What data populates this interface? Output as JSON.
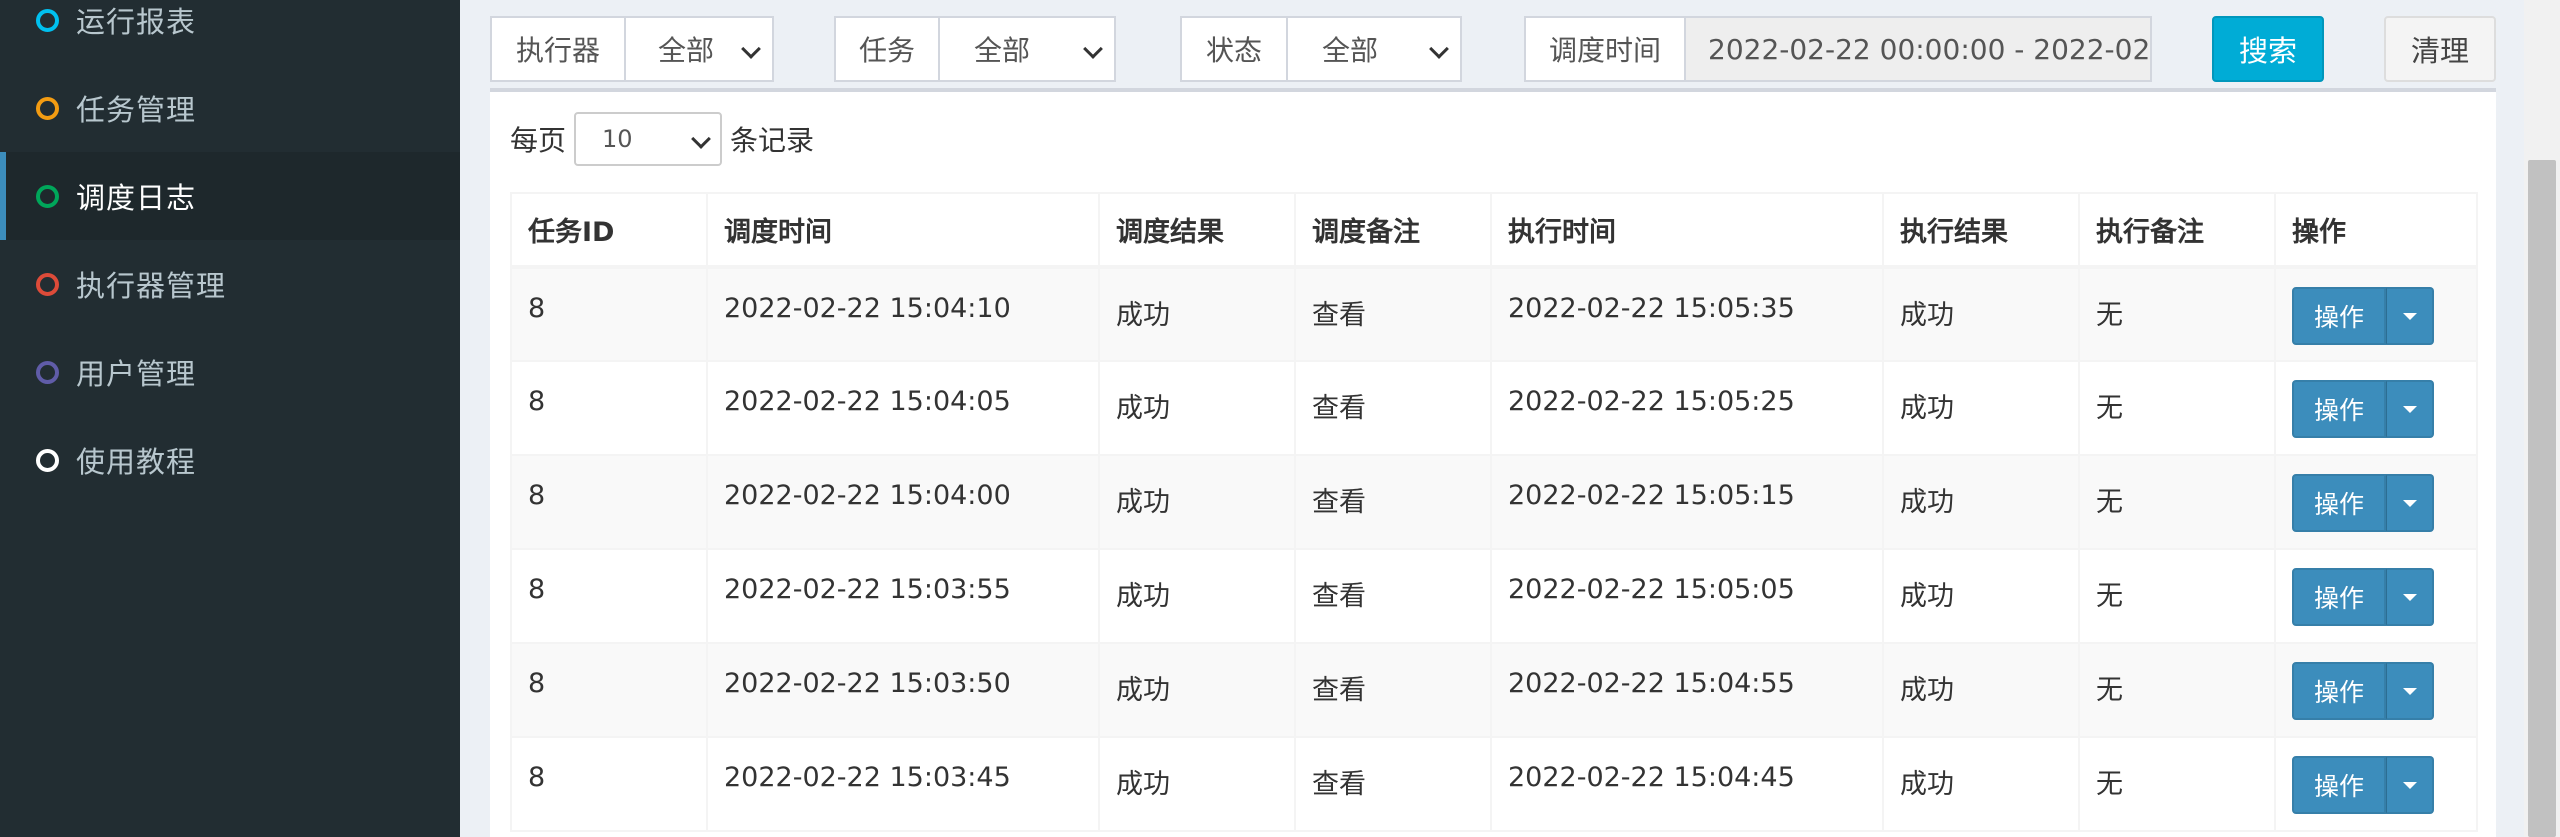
{
  "sidebar": {
    "items": [
      {
        "label": "运行报表",
        "color": "#00c0ef",
        "active": false
      },
      {
        "label": "任务管理",
        "color": "#f39c12",
        "active": false
      },
      {
        "label": "调度日志",
        "color": "#00a65a",
        "active": true
      },
      {
        "label": "执行器管理",
        "color": "#dd4b39",
        "active": false
      },
      {
        "label": "用户管理",
        "color": "#605ca8",
        "active": false
      },
      {
        "label": "使用教程",
        "color": "#ffffff",
        "active": false
      }
    ]
  },
  "filters": {
    "executor": {
      "label": "执行器",
      "value": "全部"
    },
    "task": {
      "label": "任务",
      "value": "全部"
    },
    "status": {
      "label": "状态",
      "value": "全部"
    },
    "time": {
      "label": "调度时间",
      "value": "2022-02-22 00:00:00 - 2022-02-2"
    },
    "search_label": "搜索",
    "clear_label": "清理"
  },
  "page_size": {
    "prefix": "每页",
    "value": "10",
    "suffix": "条记录"
  },
  "table": {
    "headers": [
      "任务ID",
      "调度时间",
      "调度结果",
      "调度备注",
      "执行时间",
      "执行结果",
      "执行备注",
      "操作"
    ],
    "rows": [
      {
        "id": "8",
        "trigger_time": "2022-02-22 15:04:10",
        "trigger_result": "成功",
        "trigger_note": "查看",
        "exec_time": "2022-02-22 15:05:35",
        "exec_result": "成功",
        "exec_note": "无",
        "op": "操作"
      },
      {
        "id": "8",
        "trigger_time": "2022-02-22 15:04:05",
        "trigger_result": "成功",
        "trigger_note": "查看",
        "exec_time": "2022-02-22 15:05:25",
        "exec_result": "成功",
        "exec_note": "无",
        "op": "操作"
      },
      {
        "id": "8",
        "trigger_time": "2022-02-22 15:04:00",
        "trigger_result": "成功",
        "trigger_note": "查看",
        "exec_time": "2022-02-22 15:05:15",
        "exec_result": "成功",
        "exec_note": "无",
        "op": "操作"
      },
      {
        "id": "8",
        "trigger_time": "2022-02-22 15:03:55",
        "trigger_result": "成功",
        "trigger_note": "查看",
        "exec_time": "2022-02-22 15:05:05",
        "exec_result": "成功",
        "exec_note": "无",
        "op": "操作"
      },
      {
        "id": "8",
        "trigger_time": "2022-02-22 15:03:50",
        "trigger_result": "成功",
        "trigger_note": "查看",
        "exec_time": "2022-02-22 15:04:55",
        "exec_result": "成功",
        "exec_note": "无",
        "op": "操作"
      },
      {
        "id": "8",
        "trigger_time": "2022-02-22 15:03:45",
        "trigger_result": "成功",
        "trigger_note": "查看",
        "exec_time": "2022-02-22 15:04:45",
        "exec_result": "成功",
        "exec_note": "无",
        "op": "操作"
      }
    ]
  },
  "colors": {
    "sidebar_bg": "#222d32",
    "accent": "#3c8dbc",
    "success": "#008000",
    "search_button": "#00acd6"
  }
}
